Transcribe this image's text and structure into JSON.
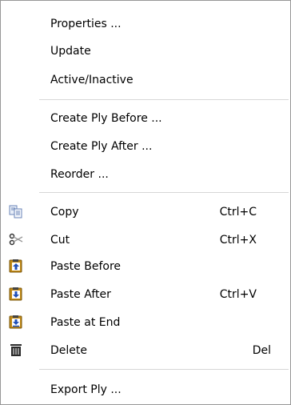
{
  "menu": {
    "items": [
      {
        "label": "Properties ...",
        "shortcut": ""
      },
      {
        "label": "Update",
        "shortcut": ""
      },
      {
        "label": "Active/Inactive",
        "shortcut": ""
      },
      {
        "label": "Create Ply Before ...",
        "shortcut": ""
      },
      {
        "label": "Create Ply After ...",
        "shortcut": ""
      },
      {
        "label": "Reorder ...",
        "shortcut": ""
      },
      {
        "label": "Copy",
        "shortcut": "Ctrl+C",
        "icon": "copy-icon"
      },
      {
        "label": "Cut",
        "shortcut": "Ctrl+X",
        "icon": "scissors-icon"
      },
      {
        "label": "Paste Before",
        "shortcut": "",
        "icon": "paste-before-icon"
      },
      {
        "label": "Paste After",
        "shortcut": "Ctrl+V",
        "icon": "paste-after-icon"
      },
      {
        "label": "Paste at End",
        "shortcut": "",
        "icon": "paste-at-end-icon"
      },
      {
        "label": "Delete",
        "shortcut": "Del",
        "icon": "trash-icon"
      },
      {
        "label": "Export Ply ...",
        "shortcut": ""
      }
    ]
  },
  "colors": {
    "border": "#979797",
    "separator": "#d7d7d7",
    "clipboard": "#c28a16",
    "arrow": "#1f4fb8",
    "trash": "#2b2b2b"
  }
}
